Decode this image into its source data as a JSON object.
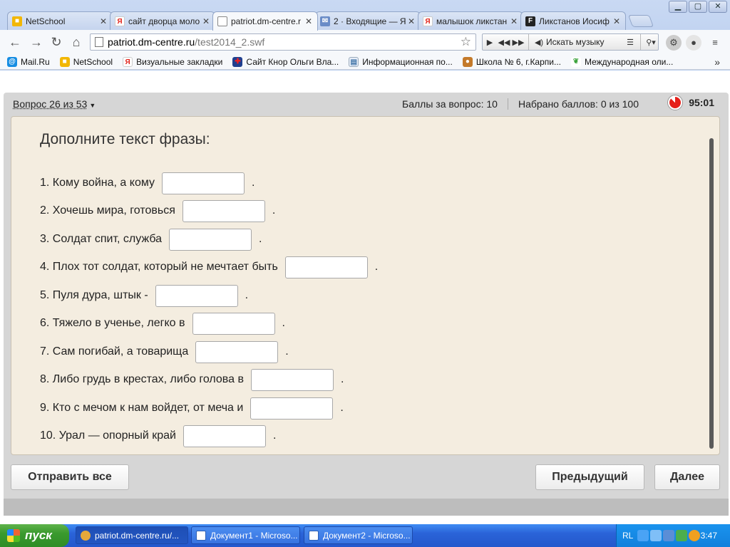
{
  "browser": {
    "tabs": [
      {
        "title": "NetSchool",
        "icon": "netschool-icon",
        "color": "#f2b705"
      },
      {
        "title": "сайт дворца моло",
        "icon": "yandex-icon",
        "color": "#e2231a"
      },
      {
        "title": "patriot.dm-centre.r",
        "icon": "page-icon",
        "color": "#ffffff"
      },
      {
        "title": "2 · Входящие — Я",
        "icon": "mail-icon",
        "color": "#6a8cc7"
      },
      {
        "title": "малышок ликстан",
        "icon": "yandex-icon",
        "color": "#e2231a"
      },
      {
        "title": "Ликстанов Иосиф",
        "icon": "fr-icon",
        "color": "#222222"
      }
    ],
    "window_controls": [
      "▁",
      "▢",
      "✕"
    ],
    "url_host": "patriot.dm-centre.ru",
    "url_path": "/test2014_2.swf",
    "music_search": "Искать музыку",
    "bookmarks": [
      {
        "label": "Mail.Ru",
        "color": "#168de2"
      },
      {
        "label": "NetSchool",
        "color": "#f2b705"
      },
      {
        "label": "Визуальные закладки",
        "color": "#e2231a"
      },
      {
        "label": "Сайт Кнор Ольги Вла...",
        "color": "#c8102e"
      },
      {
        "label": "Информационная по...",
        "color": "#7a9cc7"
      },
      {
        "label": "Школа № 6, г.Карпи...",
        "color": "#c47a2a"
      },
      {
        "label": "Международная оли...",
        "color": "#3aa23a"
      }
    ]
  },
  "quiz": {
    "question_selector": "Вопрос 26 из 53",
    "points_per_question": "Баллы за вопрос: 10",
    "points_total": "Набрано баллов: 0 из 100",
    "timer": "95:01",
    "title": "Дополните текст фразы:",
    "lines": [
      {
        "text": "1. Кому война, а кому"
      },
      {
        "text": "2. Хочешь мира, готовься"
      },
      {
        "text": "3. Солдат спит, служба"
      },
      {
        "text": "4. Плох тот солдат, который не мечтает быть"
      },
      {
        "text": "5. Пуля дура, штык -"
      },
      {
        "text": "6. Тяжело в ученье, легко в"
      },
      {
        "text": "7. Сам погибай, а товарища"
      },
      {
        "text": "8. Либо грудь в крестах, либо голова в"
      },
      {
        "text": "9. Кто с мечом к нам войдет, от меча и"
      },
      {
        "text": "10. Урал — опорный край"
      }
    ],
    "period": ".",
    "buttons": {
      "submit_all": "Отправить все",
      "previous": "Предыдущий",
      "next": "Далее"
    }
  },
  "taskbar": {
    "start": "пуск",
    "tasks": [
      {
        "label": "patriot.dm-centre.ru/...",
        "color": "#e5a83a"
      },
      {
        "label": "Документ1 - Microso...",
        "color": "#2b5fb4"
      },
      {
        "label": "Документ2 - Microso...",
        "color": "#2b5fb4"
      }
    ],
    "lang": "RL",
    "clock": "3:47"
  }
}
